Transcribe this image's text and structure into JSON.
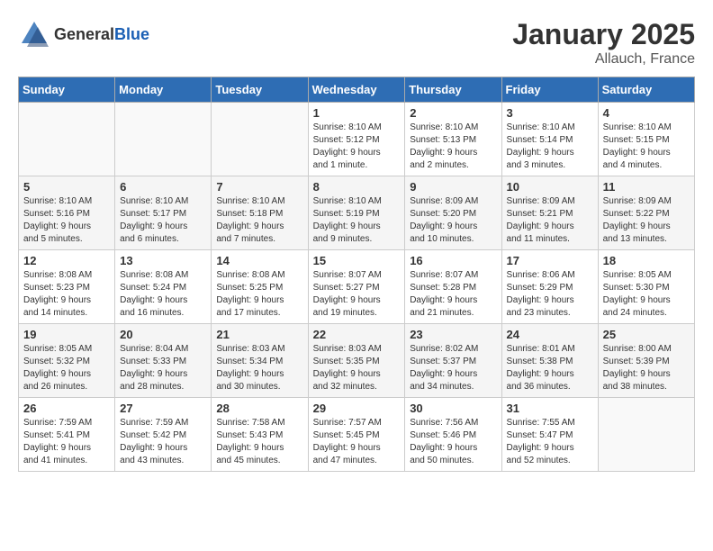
{
  "logo": {
    "text_general": "General",
    "text_blue": "Blue"
  },
  "title": "January 2025",
  "location": "Allauch, France",
  "weekdays": [
    "Sunday",
    "Monday",
    "Tuesday",
    "Wednesday",
    "Thursday",
    "Friday",
    "Saturday"
  ],
  "weeks": [
    [
      {
        "day": "",
        "info": ""
      },
      {
        "day": "",
        "info": ""
      },
      {
        "day": "",
        "info": ""
      },
      {
        "day": "1",
        "info": "Sunrise: 8:10 AM\nSunset: 5:12 PM\nDaylight: 9 hours\nand 1 minute."
      },
      {
        "day": "2",
        "info": "Sunrise: 8:10 AM\nSunset: 5:13 PM\nDaylight: 9 hours\nand 2 minutes."
      },
      {
        "day": "3",
        "info": "Sunrise: 8:10 AM\nSunset: 5:14 PM\nDaylight: 9 hours\nand 3 minutes."
      },
      {
        "day": "4",
        "info": "Sunrise: 8:10 AM\nSunset: 5:15 PM\nDaylight: 9 hours\nand 4 minutes."
      }
    ],
    [
      {
        "day": "5",
        "info": "Sunrise: 8:10 AM\nSunset: 5:16 PM\nDaylight: 9 hours\nand 5 minutes."
      },
      {
        "day": "6",
        "info": "Sunrise: 8:10 AM\nSunset: 5:17 PM\nDaylight: 9 hours\nand 6 minutes."
      },
      {
        "day": "7",
        "info": "Sunrise: 8:10 AM\nSunset: 5:18 PM\nDaylight: 9 hours\nand 7 minutes."
      },
      {
        "day": "8",
        "info": "Sunrise: 8:10 AM\nSunset: 5:19 PM\nDaylight: 9 hours\nand 9 minutes."
      },
      {
        "day": "9",
        "info": "Sunrise: 8:09 AM\nSunset: 5:20 PM\nDaylight: 9 hours\nand 10 minutes."
      },
      {
        "day": "10",
        "info": "Sunrise: 8:09 AM\nSunset: 5:21 PM\nDaylight: 9 hours\nand 11 minutes."
      },
      {
        "day": "11",
        "info": "Sunrise: 8:09 AM\nSunset: 5:22 PM\nDaylight: 9 hours\nand 13 minutes."
      }
    ],
    [
      {
        "day": "12",
        "info": "Sunrise: 8:08 AM\nSunset: 5:23 PM\nDaylight: 9 hours\nand 14 minutes."
      },
      {
        "day": "13",
        "info": "Sunrise: 8:08 AM\nSunset: 5:24 PM\nDaylight: 9 hours\nand 16 minutes."
      },
      {
        "day": "14",
        "info": "Sunrise: 8:08 AM\nSunset: 5:25 PM\nDaylight: 9 hours\nand 17 minutes."
      },
      {
        "day": "15",
        "info": "Sunrise: 8:07 AM\nSunset: 5:27 PM\nDaylight: 9 hours\nand 19 minutes."
      },
      {
        "day": "16",
        "info": "Sunrise: 8:07 AM\nSunset: 5:28 PM\nDaylight: 9 hours\nand 21 minutes."
      },
      {
        "day": "17",
        "info": "Sunrise: 8:06 AM\nSunset: 5:29 PM\nDaylight: 9 hours\nand 23 minutes."
      },
      {
        "day": "18",
        "info": "Sunrise: 8:05 AM\nSunset: 5:30 PM\nDaylight: 9 hours\nand 24 minutes."
      }
    ],
    [
      {
        "day": "19",
        "info": "Sunrise: 8:05 AM\nSunset: 5:32 PM\nDaylight: 9 hours\nand 26 minutes."
      },
      {
        "day": "20",
        "info": "Sunrise: 8:04 AM\nSunset: 5:33 PM\nDaylight: 9 hours\nand 28 minutes."
      },
      {
        "day": "21",
        "info": "Sunrise: 8:03 AM\nSunset: 5:34 PM\nDaylight: 9 hours\nand 30 minutes."
      },
      {
        "day": "22",
        "info": "Sunrise: 8:03 AM\nSunset: 5:35 PM\nDaylight: 9 hours\nand 32 minutes."
      },
      {
        "day": "23",
        "info": "Sunrise: 8:02 AM\nSunset: 5:37 PM\nDaylight: 9 hours\nand 34 minutes."
      },
      {
        "day": "24",
        "info": "Sunrise: 8:01 AM\nSunset: 5:38 PM\nDaylight: 9 hours\nand 36 minutes."
      },
      {
        "day": "25",
        "info": "Sunrise: 8:00 AM\nSunset: 5:39 PM\nDaylight: 9 hours\nand 38 minutes."
      }
    ],
    [
      {
        "day": "26",
        "info": "Sunrise: 7:59 AM\nSunset: 5:41 PM\nDaylight: 9 hours\nand 41 minutes."
      },
      {
        "day": "27",
        "info": "Sunrise: 7:59 AM\nSunset: 5:42 PM\nDaylight: 9 hours\nand 43 minutes."
      },
      {
        "day": "28",
        "info": "Sunrise: 7:58 AM\nSunset: 5:43 PM\nDaylight: 9 hours\nand 45 minutes."
      },
      {
        "day": "29",
        "info": "Sunrise: 7:57 AM\nSunset: 5:45 PM\nDaylight: 9 hours\nand 47 minutes."
      },
      {
        "day": "30",
        "info": "Sunrise: 7:56 AM\nSunset: 5:46 PM\nDaylight: 9 hours\nand 50 minutes."
      },
      {
        "day": "31",
        "info": "Sunrise: 7:55 AM\nSunset: 5:47 PM\nDaylight: 9 hours\nand 52 minutes."
      },
      {
        "day": "",
        "info": ""
      }
    ]
  ]
}
